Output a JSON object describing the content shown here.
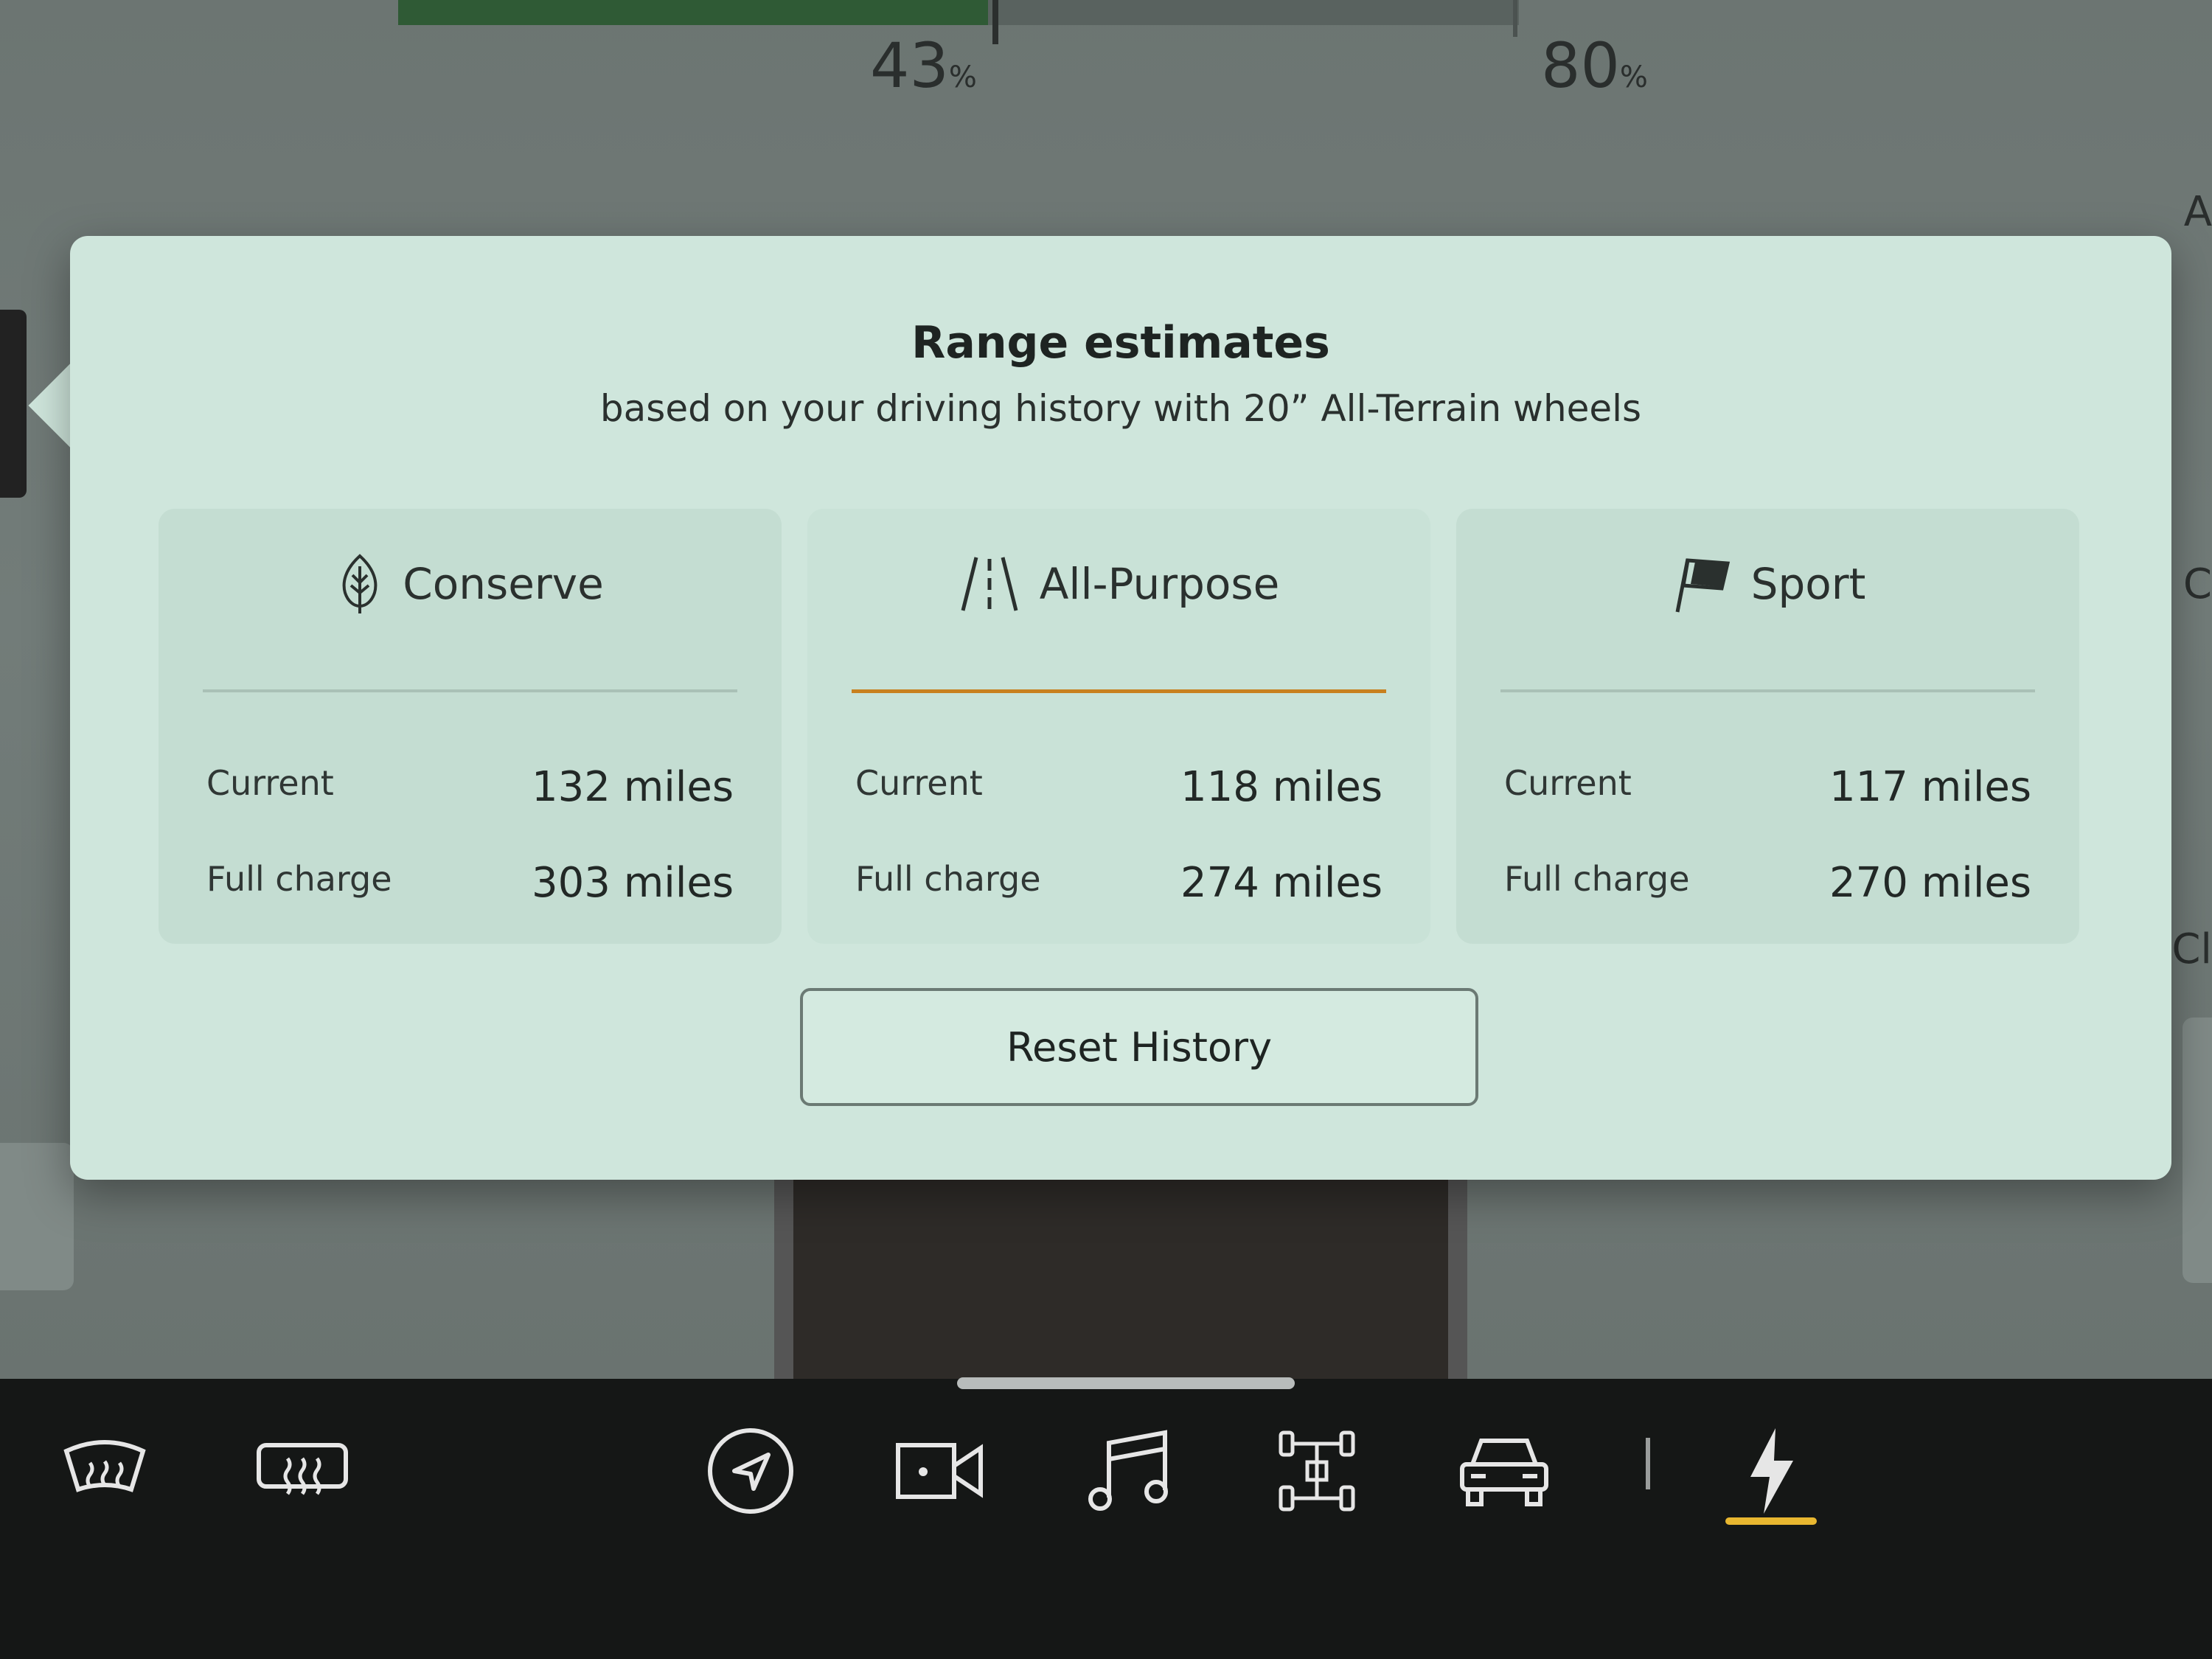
{
  "battery": {
    "current_percent": "43",
    "limit_percent": "80",
    "unit": "%",
    "fill_fraction": 0.43
  },
  "side_letters": [
    "A",
    "C",
    "Cl"
  ],
  "popup": {
    "title": "Range estimates",
    "subtitle": "based on your driving history with 20” All-Terrain wheels",
    "modes": [
      {
        "name": "Conserve",
        "icon": "leaf-icon",
        "current_label": "Current",
        "current_value": "132 miles",
        "full_label": "Full charge",
        "full_value": "303 miles",
        "selected": false
      },
      {
        "name": "All-Purpose",
        "icon": "road-icon",
        "current_label": "Current",
        "current_value": "118 miles",
        "full_label": "Full charge",
        "full_value": "274 miles",
        "selected": true
      },
      {
        "name": "Sport",
        "icon": "flag-icon",
        "current_label": "Current",
        "current_value": "117 miles",
        "full_label": "Full charge",
        "full_value": "270 miles",
        "selected": false
      }
    ],
    "reset_button": "Reset History"
  },
  "dock": {
    "items": [
      "front-defrost-icon",
      "rear-defrost-icon",
      "navigation-icon",
      "camera-icon",
      "music-icon",
      "drivetrain-icon",
      "vehicle-icon",
      "energy-icon"
    ],
    "active": "energy-icon",
    "accent": "#e8b730"
  }
}
